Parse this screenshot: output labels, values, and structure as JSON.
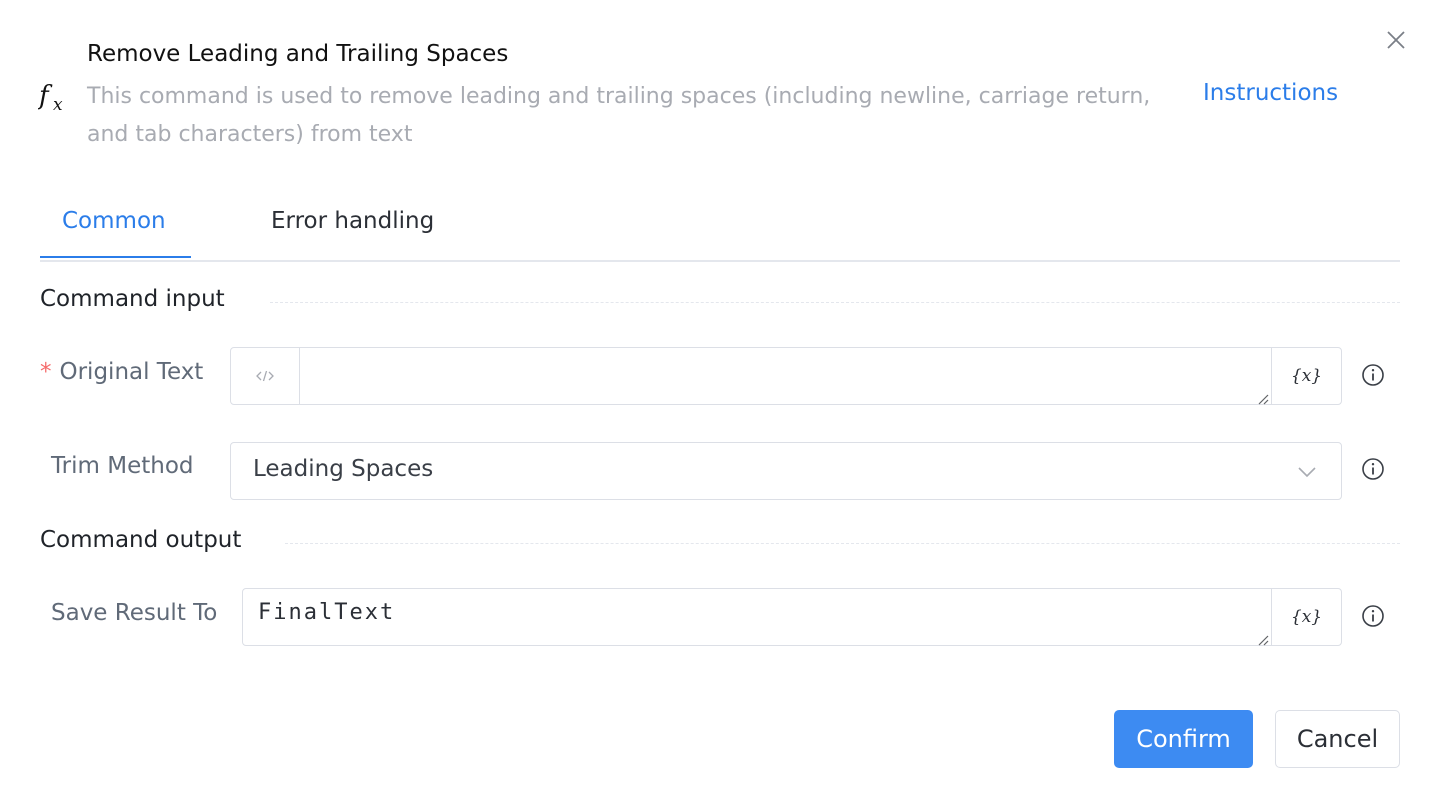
{
  "dialog": {
    "title": "Remove Leading and Trailing Spaces",
    "description": "This command is used to remove leading and trailing spaces (including newline, carriage return, and tab characters) from text",
    "instructions_link": "Instructions",
    "close_icon": "close-icon",
    "command_icon": "function-fx-icon"
  },
  "tabs": [
    {
      "label": "Common",
      "active": true
    },
    {
      "label": "Error handling",
      "active": false
    }
  ],
  "sections": {
    "input_title": "Command input",
    "output_title": "Command output"
  },
  "fields": {
    "original_text": {
      "required_mark": "*",
      "label": "Original Text",
      "value": "",
      "prefix_icon": "code-icon",
      "variable_button": "{x}"
    },
    "trim_method": {
      "label": "Trim Method",
      "value": "Leading Spaces",
      "dropdown_icon": "chevron-down-icon"
    },
    "save_result_to": {
      "label": "Save Result To",
      "value": "FinalText",
      "variable_button": "{x}"
    }
  },
  "footer": {
    "confirm_label": "Confirm",
    "cancel_label": "Cancel"
  },
  "colors": {
    "accent": "#2b7de9",
    "confirm_bg": "#3d8bf2",
    "required": "#f56c6c",
    "muted_text": "#a8abb2",
    "border": "#dcdfe6"
  }
}
